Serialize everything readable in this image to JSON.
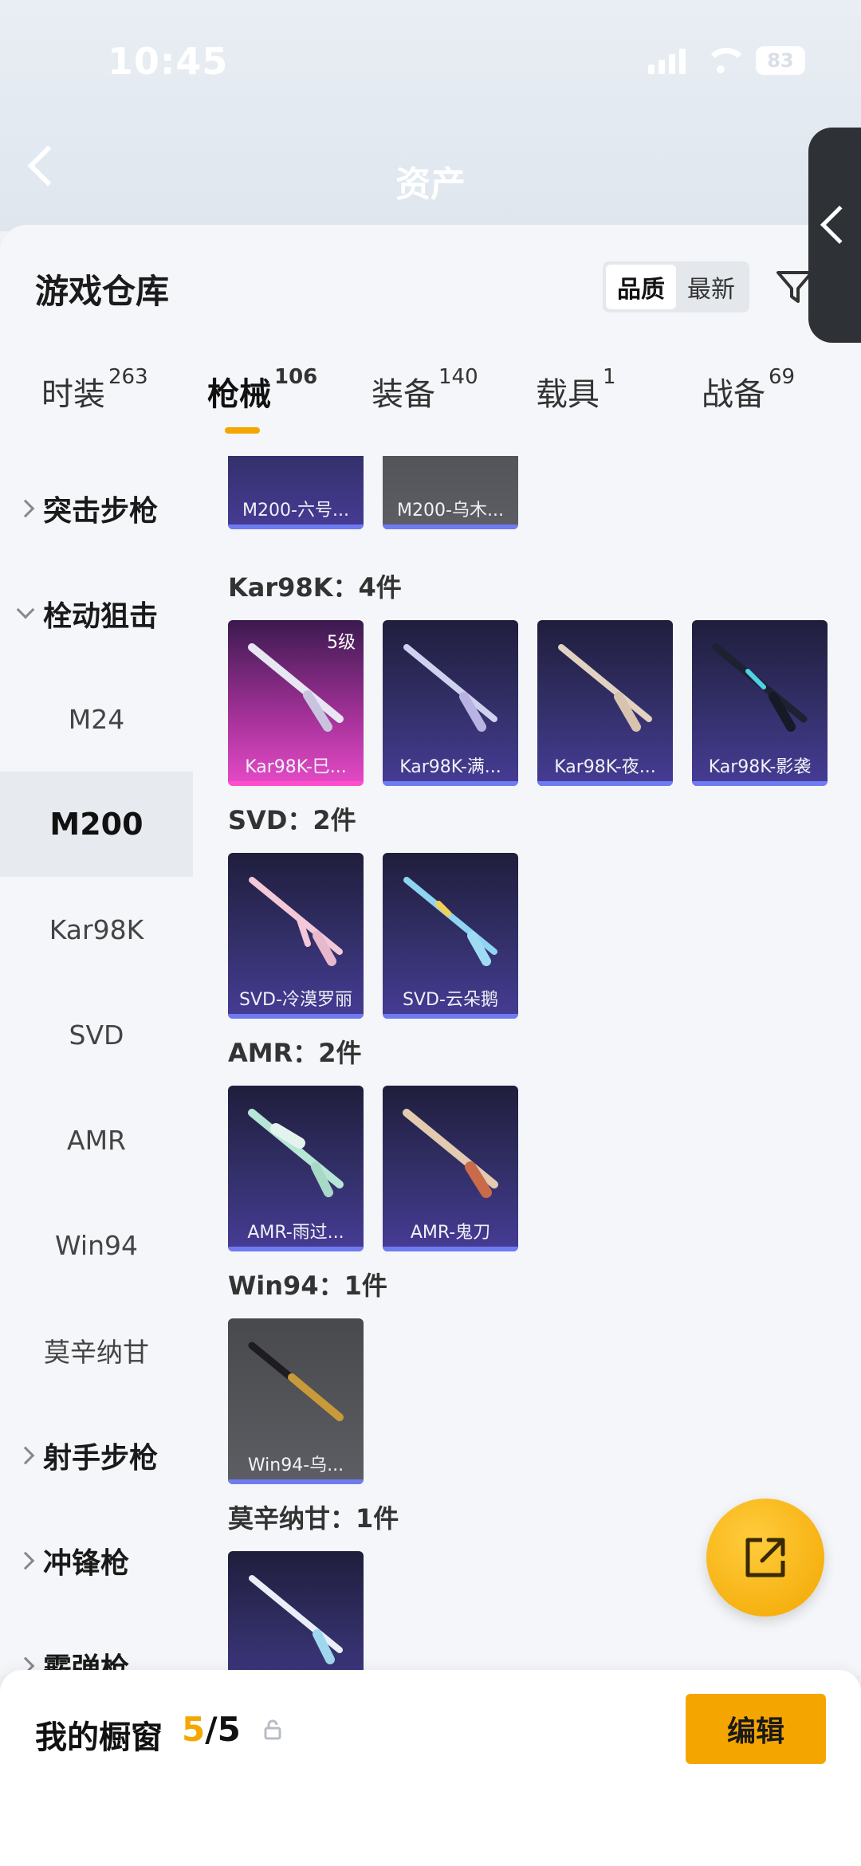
{
  "status_bar": {
    "time": "10:45",
    "battery": "83"
  },
  "header": {
    "title": "资产"
  },
  "sheet": {
    "title": "游戏仓库",
    "sort": {
      "options": [
        "品质",
        "最新"
      ],
      "active": "品质"
    }
  },
  "tabs": [
    {
      "label": "时装",
      "count": "263"
    },
    {
      "label": "枪械",
      "count": "106"
    },
    {
      "label": "装备",
      "count": "140"
    },
    {
      "label": "载具",
      "count": "1"
    },
    {
      "label": "战备",
      "count": "69"
    }
  ],
  "active_tab": "枪械",
  "nav": {
    "items": [
      {
        "label": "突击步枪",
        "type": "group",
        "open": false
      },
      {
        "label": "栓动狙击",
        "type": "group",
        "open": true
      },
      {
        "label": "M24",
        "type": "sub"
      },
      {
        "label": "M200",
        "type": "sub",
        "selected": true
      },
      {
        "label": "Kar98K",
        "type": "sub"
      },
      {
        "label": "SVD",
        "type": "sub"
      },
      {
        "label": "AMR",
        "type": "sub"
      },
      {
        "label": "Win94",
        "type": "sub"
      },
      {
        "label": "莫辛纳甘",
        "type": "sub"
      },
      {
        "label": "射手步枪",
        "type": "group",
        "open": false
      },
      {
        "label": "冲锋枪",
        "type": "group",
        "open": false
      },
      {
        "label": "霰弹枪",
        "type": "group",
        "open": false
      }
    ]
  },
  "sections": [
    {
      "title": "",
      "cards": [
        {
          "label": "M200-六号...",
          "style": "purple"
        },
        {
          "label": "M200-乌木...",
          "style": "gray"
        }
      ]
    },
    {
      "title": "Kar98K：4件",
      "cards": [
        {
          "label": "Kar98K-巳...",
          "style": "pink",
          "level": "5级"
        },
        {
          "label": "Kar98K-满...",
          "style": "purple"
        },
        {
          "label": "Kar98K-夜...",
          "style": "purple"
        },
        {
          "label": "Kar98K-影袭",
          "style": "purple"
        }
      ]
    },
    {
      "title": "SVD：2件",
      "cards": [
        {
          "label": "SVD-冷漠罗丽",
          "style": "purple"
        },
        {
          "label": "SVD-云朵鹅",
          "style": "purple"
        }
      ]
    },
    {
      "title": "AMR：2件",
      "cards": [
        {
          "label": "AMR-雨过...",
          "style": "purple"
        },
        {
          "label": "AMR-鬼刀",
          "style": "purple"
        }
      ]
    },
    {
      "title": "Win94：1件",
      "cards": [
        {
          "label": "Win94-乌...",
          "style": "gray"
        }
      ]
    },
    {
      "title": "莫辛纳甘：1件",
      "cards": [
        {
          "label": "",
          "style": "purple"
        }
      ]
    }
  ],
  "showcase": {
    "title": "我的橱窗",
    "used": "5",
    "total": "/5",
    "edit_label": "编辑"
  },
  "colors": {
    "accent": "#f5a500",
    "card_purple": "#3a3470",
    "card_pink": "#c63bb2",
    "card_gray": "#55565b"
  },
  "icons": [
    "back-arrow-icon",
    "filter-icon",
    "chevron-right-icon",
    "chevron-down-icon",
    "share-external-icon",
    "lock-icon",
    "rifle-icon"
  ]
}
